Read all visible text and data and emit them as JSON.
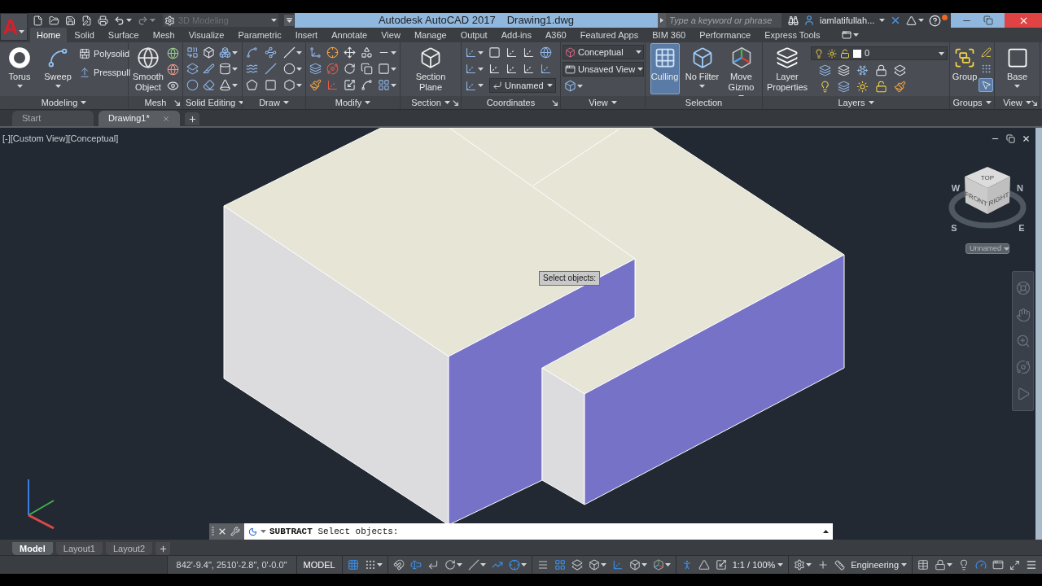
{
  "app_button": {
    "letter": "A"
  },
  "quick_access": {
    "workspace": "3D Modeling"
  },
  "title_bar": {
    "title": "Autodesk AutoCAD 2017",
    "document": "Drawing1.dwg"
  },
  "search": {
    "placeholder": "Type a keyword or phrase"
  },
  "account": {
    "user": "iamlatifullah..."
  },
  "ribbon_tabs": [
    {
      "label": "Home",
      "selected": true
    },
    {
      "label": "Solid",
      "selected": false
    },
    {
      "label": "Surface",
      "selected": false
    },
    {
      "label": "Mesh",
      "selected": false
    },
    {
      "label": "Visualize",
      "selected": false
    },
    {
      "label": "Parametric",
      "selected": false
    },
    {
      "label": "Insert",
      "selected": false
    },
    {
      "label": "Annotate",
      "selected": false
    },
    {
      "label": "View",
      "selected": false
    },
    {
      "label": "Manage",
      "selected": false
    },
    {
      "label": "Output",
      "selected": false
    },
    {
      "label": "Add-ins",
      "selected": false
    },
    {
      "label": "A360",
      "selected": false
    },
    {
      "label": "Featured Apps",
      "selected": false
    },
    {
      "label": "BIM 360",
      "selected": false
    },
    {
      "label": "Performance",
      "selected": false
    },
    {
      "label": "Express Tools",
      "selected": false
    }
  ],
  "ribbon_panels": [
    {
      "kind": "modeling",
      "title": "Modeling",
      "large": [
        {
          "label": "Torus"
        },
        {
          "label": "Sweep"
        }
      ],
      "small": [
        {
          "label": "Polysolid"
        },
        {
          "label": "Presspull"
        }
      ]
    },
    {
      "kind": "mesh",
      "title": "Mesh",
      "large": [
        {
          "label": "Smooth Object"
        }
      ]
    },
    {
      "kind": "solidedit",
      "title": "Solid Editing"
    },
    {
      "kind": "draw",
      "title": "Draw"
    },
    {
      "kind": "modify",
      "title": "Modify"
    },
    {
      "kind": "section",
      "title": "Section",
      "large": [
        {
          "label": "Section Plane"
        }
      ]
    },
    {
      "kind": "coordinates",
      "title": "Coordinates",
      "dropdown": "Unnamed"
    },
    {
      "kind": "views",
      "title": "View",
      "dropdowns": [
        "Conceptual",
        "Unsaved View"
      ]
    },
    {
      "kind": "selection",
      "title": "Selection",
      "large": [
        {
          "label": "Culling",
          "on": true
        },
        {
          "label": "No Filter",
          "on": false
        },
        {
          "label": "Move Gizmo",
          "on": false
        }
      ]
    },
    {
      "kind": "layers",
      "title": "Layers",
      "large": [
        {
          "label": "Layer Properties"
        }
      ],
      "layer": "0"
    },
    {
      "kind": "groups",
      "title": "Groups",
      "large": [
        {
          "label": "Group"
        }
      ],
      "small": [
        {
          "on": false
        },
        {
          "on": false
        },
        {
          "on": true
        }
      ]
    },
    {
      "kind": "base",
      "title": "View",
      "large": [
        {
          "label": "Base"
        }
      ]
    }
  ],
  "file_tabs": [
    {
      "label": "Start",
      "selected": false
    },
    {
      "label": "Drawing1*",
      "selected": true
    }
  ],
  "viewport": {
    "label": "[-][Custom View][Conceptual]",
    "tooltip": "Select objects:",
    "viewcube": {
      "faces": [
        "TOP",
        "FRONT",
        "RIGHT"
      ],
      "compass": [
        "W",
        "N",
        "S",
        "E"
      ]
    },
    "ucs": "Unnamed"
  },
  "command_line": {
    "text": "**SUBTRACT** Select objects:"
  },
  "layout_tabs": [
    {
      "label": "Model",
      "selected": true
    },
    {
      "label": "Layout1",
      "selected": false
    },
    {
      "label": "Layout2",
      "selected": false
    }
  ],
  "status_bar": {
    "coordinates": "842'-9.4\", 2510'-2.8\", 0'-0.0\"",
    "space": "MODEL",
    "toggles": [
      {
        "on": true
      },
      {
        "on": false
      },
      {
        "on": false
      },
      {
        "on": true
      },
      {
        "on": false
      },
      {
        "on": false
      },
      {
        "on": false
      },
      {
        "on": true
      },
      {
        "on": true
      },
      {
        "on": false
      },
      {
        "on": true
      },
      {
        "on": false
      },
      {
        "on": false
      },
      {
        "on": true
      },
      {
        "on": false
      },
      {
        "on": true
      },
      {
        "on": false
      }
    ],
    "scale": "1:1 / 100%",
    "units": "Engineering",
    "tray": [
      {
        "on": false
      },
      {
        "on": false
      },
      {
        "on": false
      },
      {
        "on": true
      },
      {
        "on": false
      }
    ]
  }
}
